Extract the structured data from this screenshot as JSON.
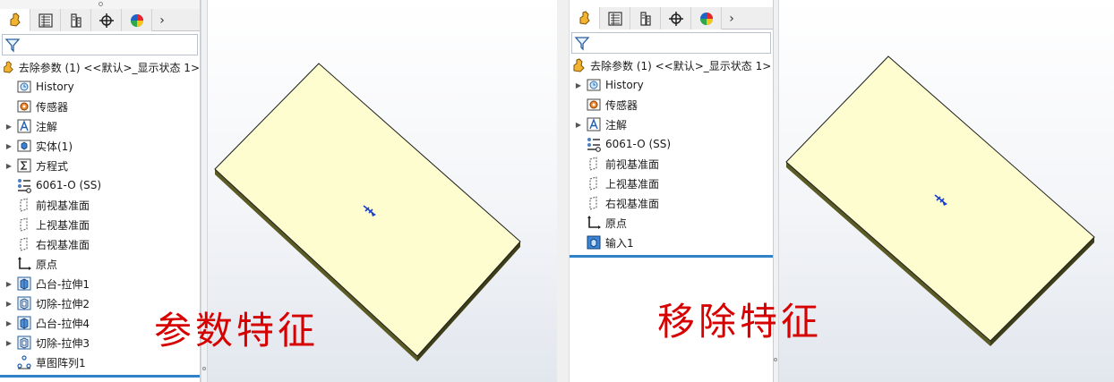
{
  "colors": {
    "accent": "#2f82c8",
    "part_face": "#fdfdd0",
    "part_edge": "#545422",
    "caption": "#d70000"
  },
  "tabs_icons": [
    "feature-manager-icon",
    "property-manager-icon",
    "configuration-manager-icon",
    "dimxpert-icon",
    "display-manager-icon"
  ],
  "more_label": "›",
  "left": {
    "root_label": "去除参数 (1) <<默认>_显示状态 1>",
    "items": [
      {
        "icon": "history-icon",
        "label": "History",
        "expandable": false
      },
      {
        "icon": "sensors-icon",
        "label": "传感器",
        "expandable": false
      },
      {
        "icon": "annotations-icon",
        "label": "注解",
        "expandable": true
      },
      {
        "icon": "solid-bodies-icon",
        "label": "实体(1)",
        "expandable": true
      },
      {
        "icon": "equations-icon",
        "label": "方程式",
        "expandable": true
      },
      {
        "icon": "material-icon",
        "label": "6061-O (SS)",
        "expandable": false
      },
      {
        "icon": "plane-icon",
        "label": "前视基准面",
        "expandable": false
      },
      {
        "icon": "plane-icon",
        "label": "上视基准面",
        "expandable": false
      },
      {
        "icon": "plane-icon",
        "label": "右视基准面",
        "expandable": false
      },
      {
        "icon": "origin-icon",
        "label": "原点",
        "expandable": false
      },
      {
        "icon": "boss-extrude-icon",
        "label": "凸台-拉伸1",
        "expandable": true
      },
      {
        "icon": "cut-extrude-icon",
        "label": "切除-拉伸2",
        "expandable": true
      },
      {
        "icon": "boss-extrude-icon",
        "label": "凸台-拉伸4",
        "expandable": true
      },
      {
        "icon": "cut-extrude-icon",
        "label": "切除-拉伸3",
        "expandable": true
      },
      {
        "icon": "sketch-pattern-icon",
        "label": "草图阵列1",
        "expandable": false
      }
    ],
    "caption": "参数特征"
  },
  "right": {
    "root_label": "去除参数 (1) <<默认>_显示状态 1>",
    "items": [
      {
        "icon": "history-icon",
        "label": "History",
        "expandable": true
      },
      {
        "icon": "sensors-icon",
        "label": "传感器",
        "expandable": false
      },
      {
        "icon": "annotations-icon",
        "label": "注解",
        "expandable": true
      },
      {
        "icon": "material-icon",
        "label": "6061-O (SS)",
        "expandable": false
      },
      {
        "icon": "plane-icon",
        "label": "前视基准面",
        "expandable": false
      },
      {
        "icon": "plane-icon",
        "label": "上视基准面",
        "expandable": false
      },
      {
        "icon": "plane-icon",
        "label": "右视基准面",
        "expandable": false
      },
      {
        "icon": "origin-icon",
        "label": "原点",
        "expandable": false
      },
      {
        "icon": "imported-body-icon",
        "label": "输入1",
        "expandable": false
      }
    ],
    "caption": "移除特征"
  }
}
